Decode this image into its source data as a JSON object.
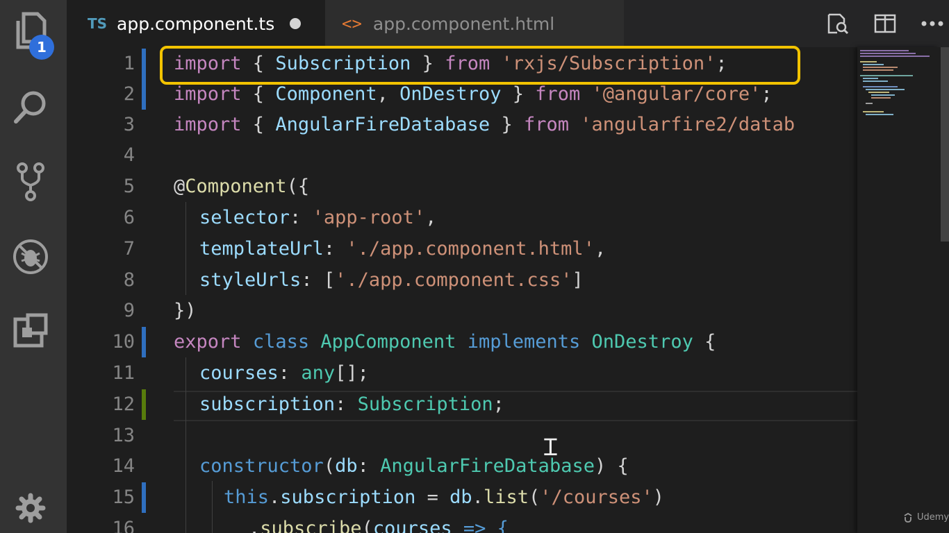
{
  "activity_bar": {
    "explorer_badge": "1",
    "items": [
      "explorer-icon",
      "search-icon",
      "source-control-icon",
      "debug-icon",
      "extensions-icon",
      "settings-gear-icon"
    ]
  },
  "tabs": [
    {
      "lang_label": "TS",
      "title": "app.component.ts",
      "active": true,
      "modified": true
    },
    {
      "lang_label": "<>",
      "title": "app.component.html",
      "active": false
    }
  ],
  "toolbar": [
    "open-preview-icon",
    "split-editor-icon",
    "more-actions-icon"
  ],
  "editor": {
    "line_numbers": [
      "1",
      "2",
      "3",
      "4",
      "5",
      "6",
      "7",
      "8",
      "9",
      "10",
      "11",
      "12",
      "13",
      "14",
      "15",
      "16"
    ],
    "highlighted_line": "1",
    "current_line": "12"
  },
  "watermark": "Udemy",
  "colors": {
    "highlight_box": "#f2c300",
    "keyword": "#c586c0",
    "string": "#ce9178",
    "class": "#4ec9b0",
    "variable": "#9cdcfe",
    "badge": "#2f6fdb"
  },
  "code": {
    "l1": [
      "import",
      " { ",
      "Subscription",
      " } ",
      "from",
      " ",
      "'rxjs/Subscription'",
      ";"
    ],
    "l2": [
      "import",
      " { ",
      "Component",
      ", ",
      "OnDestroy",
      " } ",
      "from",
      " ",
      "'@angular/core'",
      ";"
    ],
    "l3": [
      "import",
      " { ",
      "AngularFireDatabase",
      " } ",
      "from",
      " ",
      "'angularfire2/datab"
    ],
    "l5": [
      "@",
      "Component",
      "({"
    ],
    "l6": [
      "selector",
      ": ",
      "'app-root'",
      ","
    ],
    "l7": [
      "templateUrl",
      ": ",
      "'./app.component.html'",
      ","
    ],
    "l8": [
      "styleUrls",
      ": [",
      "'./app.component.css'",
      "]"
    ],
    "l9": [
      "})"
    ],
    "l10": [
      "export",
      " ",
      "class",
      " ",
      "AppComponent",
      " ",
      "implements",
      " ",
      "OnDestroy",
      " {"
    ],
    "l11": [
      "courses",
      ": ",
      "any",
      "[];"
    ],
    "l12": [
      "subscription",
      ": ",
      "Subscription",
      ";"
    ],
    "l14": [
      "constructor",
      "(",
      "db",
      ": ",
      "AngularFireDatabase",
      ") {"
    ],
    "l15": [
      "this",
      ".",
      "subscription",
      " = ",
      "db",
      ".",
      "list",
      "(",
      "'/courses'",
      ")"
    ],
    "l16": [
      ".",
      "subscribe",
      "(",
      "courses",
      " => {"
    ]
  }
}
